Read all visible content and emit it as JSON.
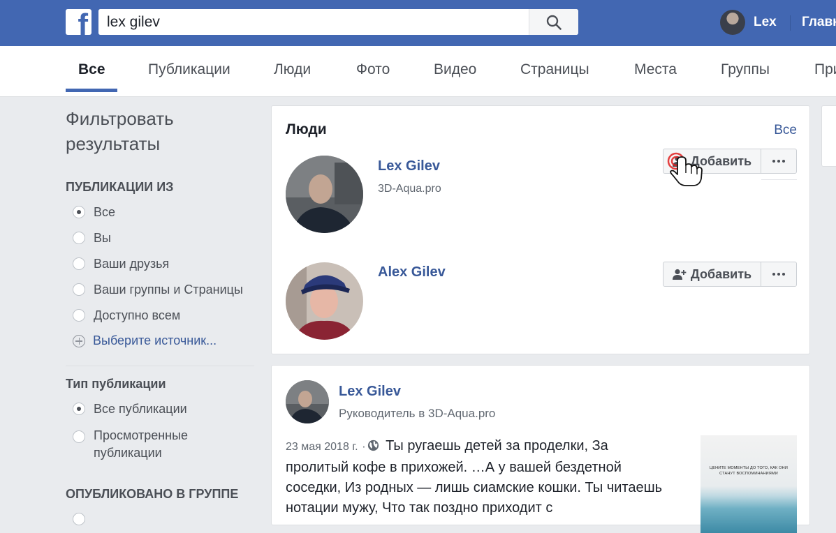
{
  "header": {
    "logo_letter": "f",
    "search_value": "lex gilev",
    "user_name": "Lex",
    "home_label": "Главн"
  },
  "tabs": [
    {
      "label": "Все",
      "active": true
    },
    {
      "label": "Публикации"
    },
    {
      "label": "Люди"
    },
    {
      "label": "Фото"
    },
    {
      "label": "Видео"
    },
    {
      "label": "Страницы"
    },
    {
      "label": "Места"
    },
    {
      "label": "Группы"
    },
    {
      "label": "При"
    }
  ],
  "filters": {
    "title": "Фильтровать результаты",
    "posts_from": {
      "heading": "ПУБЛИКАЦИИ ИЗ",
      "options": [
        "Все",
        "Вы",
        "Ваши друзья",
        "Ваши группы и Страницы",
        "Доступно всем"
      ],
      "selected": "Все",
      "choose_source": "Выберите источник..."
    },
    "post_type": {
      "heading": "Тип публикации",
      "options": [
        "Все публикации",
        "Просмотренные публикации"
      ],
      "selected": "Все публикации"
    },
    "posted_in_group": {
      "heading": "ОПУБЛИКОВАНО В ГРУППЕ"
    }
  },
  "people": {
    "title": "Люди",
    "see_all": "Все",
    "items": [
      {
        "name": "Lex Gilev",
        "subtitle": "3D-Aqua.pro",
        "add_label": "Добавить"
      },
      {
        "name": "Alex Gilev",
        "subtitle": "",
        "add_label": "Добавить"
      }
    ]
  },
  "post": {
    "author": "Lex Gilev",
    "role": "Руководитель в 3D-Aqua.pro",
    "date": "23 мая 2018 г.",
    "separator": "·",
    "text": "Ты ругаешь детей за проделки, За пролитый кофе в прихожей. …А у вашей бездетной соседки, Из родных — лишь сиамские кошки. Ты читаешь нотации мужу, Что так поздно приходит с",
    "thumbnail_caption": "ЦЕНИТЕ МОМЕНТЫ ДО ТОГО, КАК ОНИ СТАНУТ ВОСПОМИНАНИЯМИ"
  },
  "colors": {
    "brand": "#4267b2",
    "link": "#385898",
    "page_bg": "#e9ebee"
  }
}
